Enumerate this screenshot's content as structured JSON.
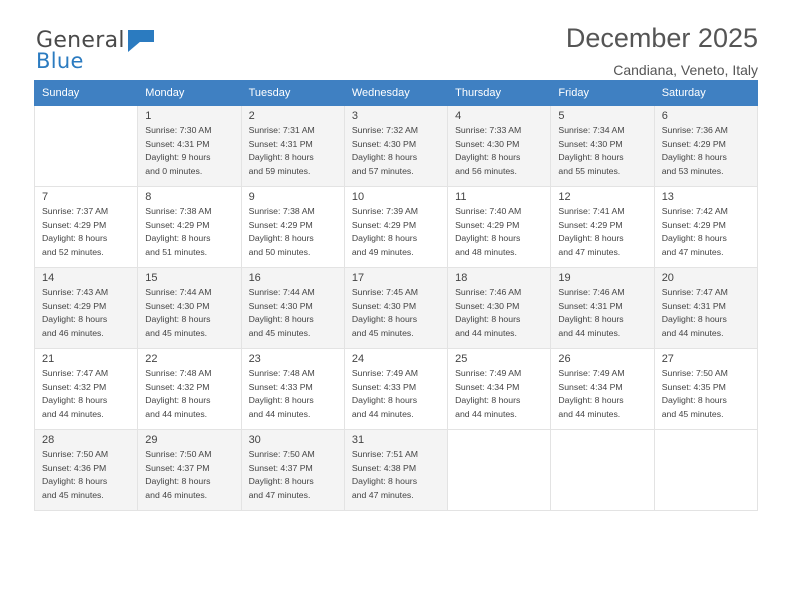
{
  "logo": {
    "line1": "General",
    "line2": "Blue",
    "icon": "flag-icon"
  },
  "header": {
    "title": "December 2025",
    "location": "Candiana, Veneto, Italy"
  },
  "calendar": {
    "weekdays": [
      "Sunday",
      "Monday",
      "Tuesday",
      "Wednesday",
      "Thursday",
      "Friday",
      "Saturday"
    ],
    "weeks": [
      [
        {
          "day": "",
          "lines": []
        },
        {
          "day": "1",
          "lines": [
            "Sunrise: 7:30 AM",
            "Sunset: 4:31 PM",
            "Daylight: 9 hours",
            "and 0 minutes."
          ]
        },
        {
          "day": "2",
          "lines": [
            "Sunrise: 7:31 AM",
            "Sunset: 4:31 PM",
            "Daylight: 8 hours",
            "and 59 minutes."
          ]
        },
        {
          "day": "3",
          "lines": [
            "Sunrise: 7:32 AM",
            "Sunset: 4:30 PM",
            "Daylight: 8 hours",
            "and 57 minutes."
          ]
        },
        {
          "day": "4",
          "lines": [
            "Sunrise: 7:33 AM",
            "Sunset: 4:30 PM",
            "Daylight: 8 hours",
            "and 56 minutes."
          ]
        },
        {
          "day": "5",
          "lines": [
            "Sunrise: 7:34 AM",
            "Sunset: 4:30 PM",
            "Daylight: 8 hours",
            "and 55 minutes."
          ]
        },
        {
          "day": "6",
          "lines": [
            "Sunrise: 7:36 AM",
            "Sunset: 4:29 PM",
            "Daylight: 8 hours",
            "and 53 minutes."
          ]
        }
      ],
      [
        {
          "day": "7",
          "lines": [
            "Sunrise: 7:37 AM",
            "Sunset: 4:29 PM",
            "Daylight: 8 hours",
            "and 52 minutes."
          ]
        },
        {
          "day": "8",
          "lines": [
            "Sunrise: 7:38 AM",
            "Sunset: 4:29 PM",
            "Daylight: 8 hours",
            "and 51 minutes."
          ]
        },
        {
          "day": "9",
          "lines": [
            "Sunrise: 7:38 AM",
            "Sunset: 4:29 PM",
            "Daylight: 8 hours",
            "and 50 minutes."
          ]
        },
        {
          "day": "10",
          "lines": [
            "Sunrise: 7:39 AM",
            "Sunset: 4:29 PM",
            "Daylight: 8 hours",
            "and 49 minutes."
          ]
        },
        {
          "day": "11",
          "lines": [
            "Sunrise: 7:40 AM",
            "Sunset: 4:29 PM",
            "Daylight: 8 hours",
            "and 48 minutes."
          ]
        },
        {
          "day": "12",
          "lines": [
            "Sunrise: 7:41 AM",
            "Sunset: 4:29 PM",
            "Daylight: 8 hours",
            "and 47 minutes."
          ]
        },
        {
          "day": "13",
          "lines": [
            "Sunrise: 7:42 AM",
            "Sunset: 4:29 PM",
            "Daylight: 8 hours",
            "and 47 minutes."
          ]
        }
      ],
      [
        {
          "day": "14",
          "lines": [
            "Sunrise: 7:43 AM",
            "Sunset: 4:29 PM",
            "Daylight: 8 hours",
            "and 46 minutes."
          ]
        },
        {
          "day": "15",
          "lines": [
            "Sunrise: 7:44 AM",
            "Sunset: 4:30 PM",
            "Daylight: 8 hours",
            "and 45 minutes."
          ]
        },
        {
          "day": "16",
          "lines": [
            "Sunrise: 7:44 AM",
            "Sunset: 4:30 PM",
            "Daylight: 8 hours",
            "and 45 minutes."
          ]
        },
        {
          "day": "17",
          "lines": [
            "Sunrise: 7:45 AM",
            "Sunset: 4:30 PM",
            "Daylight: 8 hours",
            "and 45 minutes."
          ]
        },
        {
          "day": "18",
          "lines": [
            "Sunrise: 7:46 AM",
            "Sunset: 4:30 PM",
            "Daylight: 8 hours",
            "and 44 minutes."
          ]
        },
        {
          "day": "19",
          "lines": [
            "Sunrise: 7:46 AM",
            "Sunset: 4:31 PM",
            "Daylight: 8 hours",
            "and 44 minutes."
          ]
        },
        {
          "day": "20",
          "lines": [
            "Sunrise: 7:47 AM",
            "Sunset: 4:31 PM",
            "Daylight: 8 hours",
            "and 44 minutes."
          ]
        }
      ],
      [
        {
          "day": "21",
          "lines": [
            "Sunrise: 7:47 AM",
            "Sunset: 4:32 PM",
            "Daylight: 8 hours",
            "and 44 minutes."
          ]
        },
        {
          "day": "22",
          "lines": [
            "Sunrise: 7:48 AM",
            "Sunset: 4:32 PM",
            "Daylight: 8 hours",
            "and 44 minutes."
          ]
        },
        {
          "day": "23",
          "lines": [
            "Sunrise: 7:48 AM",
            "Sunset: 4:33 PM",
            "Daylight: 8 hours",
            "and 44 minutes."
          ]
        },
        {
          "day": "24",
          "lines": [
            "Sunrise: 7:49 AM",
            "Sunset: 4:33 PM",
            "Daylight: 8 hours",
            "and 44 minutes."
          ]
        },
        {
          "day": "25",
          "lines": [
            "Sunrise: 7:49 AM",
            "Sunset: 4:34 PM",
            "Daylight: 8 hours",
            "and 44 minutes."
          ]
        },
        {
          "day": "26",
          "lines": [
            "Sunrise: 7:49 AM",
            "Sunset: 4:34 PM",
            "Daylight: 8 hours",
            "and 44 minutes."
          ]
        },
        {
          "day": "27",
          "lines": [
            "Sunrise: 7:50 AM",
            "Sunset: 4:35 PM",
            "Daylight: 8 hours",
            "and 45 minutes."
          ]
        }
      ],
      [
        {
          "day": "28",
          "lines": [
            "Sunrise: 7:50 AM",
            "Sunset: 4:36 PM",
            "Daylight: 8 hours",
            "and 45 minutes."
          ]
        },
        {
          "day": "29",
          "lines": [
            "Sunrise: 7:50 AM",
            "Sunset: 4:37 PM",
            "Daylight: 8 hours",
            "and 46 minutes."
          ]
        },
        {
          "day": "30",
          "lines": [
            "Sunrise: 7:50 AM",
            "Sunset: 4:37 PM",
            "Daylight: 8 hours",
            "and 47 minutes."
          ]
        },
        {
          "day": "31",
          "lines": [
            "Sunrise: 7:51 AM",
            "Sunset: 4:38 PM",
            "Daylight: 8 hours",
            "and 47 minutes."
          ]
        },
        {
          "day": "",
          "lines": []
        },
        {
          "day": "",
          "lines": []
        },
        {
          "day": "",
          "lines": []
        }
      ]
    ]
  },
  "colors": {
    "header_blue": "#3f80c2",
    "logo_blue": "#2b7bc0",
    "shaded_row": "#f4f4f4"
  }
}
